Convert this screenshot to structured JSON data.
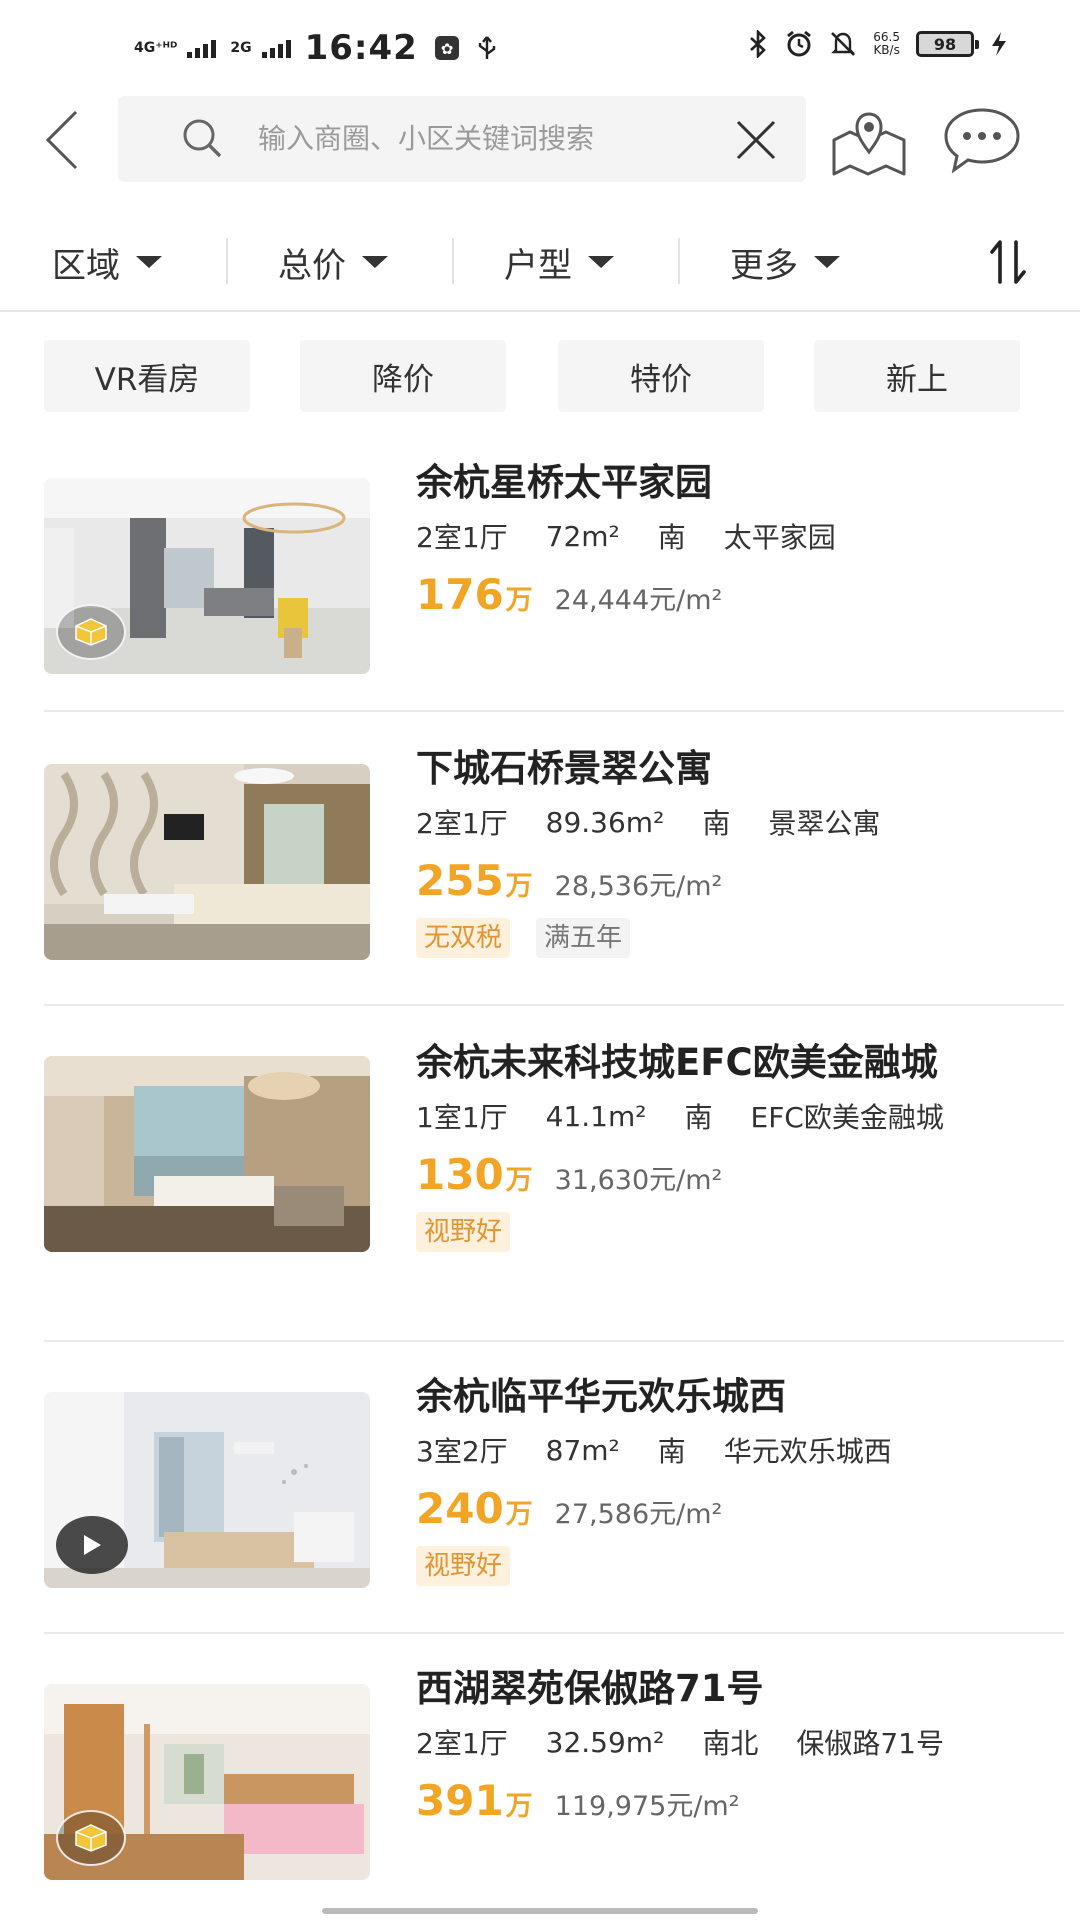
{
  "status_bar": {
    "time": "16:42",
    "network_top": "4G⁺ᴴᴰ",
    "network_sub": "2G",
    "speed_value": "66.5",
    "speed_unit": "KB/s",
    "battery": "98"
  },
  "search": {
    "placeholder": "输入商圈、小区关键词搜索"
  },
  "filters": [
    {
      "label": "区域"
    },
    {
      "label": "总价"
    },
    {
      "label": "户型"
    },
    {
      "label": "更多"
    }
  ],
  "quick_tags": [
    "VR看房",
    "降价",
    "特价",
    "新上"
  ],
  "listings": [
    {
      "title": "余杭星桥太平家园",
      "layout": "2室1厅",
      "area": "72m²",
      "orientation": "南",
      "community": "太平家园",
      "price": "176",
      "price_unit": "万",
      "unit_price": "24,444元/m²",
      "tags": [],
      "media_badge": "vr-icon"
    },
    {
      "title": "下城石桥景翠公寓",
      "layout": "2室1厅",
      "area": "89.36m²",
      "orientation": "南",
      "community": "景翠公寓",
      "price": "255",
      "price_unit": "万",
      "unit_price": "28,536元/m²",
      "tags": [
        "无双税",
        "满五年"
      ],
      "media_badge": ""
    },
    {
      "title": "余杭未来科技城EFC欧美金融城",
      "layout": "1室1厅",
      "area": "41.1m²",
      "orientation": "南",
      "community": "EFC欧美金融城",
      "price": "130",
      "price_unit": "万",
      "unit_price": "31,630元/m²",
      "tags": [
        "视野好"
      ],
      "media_badge": ""
    },
    {
      "title": "余杭临平华元欢乐城西",
      "layout": "3室2厅",
      "area": "87m²",
      "orientation": "南",
      "community": "华元欢乐城西",
      "price": "240",
      "price_unit": "万",
      "unit_price": "27,586元/m²",
      "tags": [
        "视野好"
      ],
      "media_badge": "play-icon"
    },
    {
      "title": "西湖翠苑保俶路71号",
      "layout": "2室1厅",
      "area": "32.59m²",
      "orientation": "南北",
      "community": "保俶路71号",
      "price": "391",
      "price_unit": "万",
      "unit_price": "119,975元/m²",
      "tags": [],
      "media_badge": "vr-icon"
    }
  ],
  "colors": {
    "price": "#f2a425",
    "tag_warm_bg": "#fdf0dc",
    "tag_warm_text": "#e39432",
    "tag_gray_bg": "#f3f3f3"
  }
}
